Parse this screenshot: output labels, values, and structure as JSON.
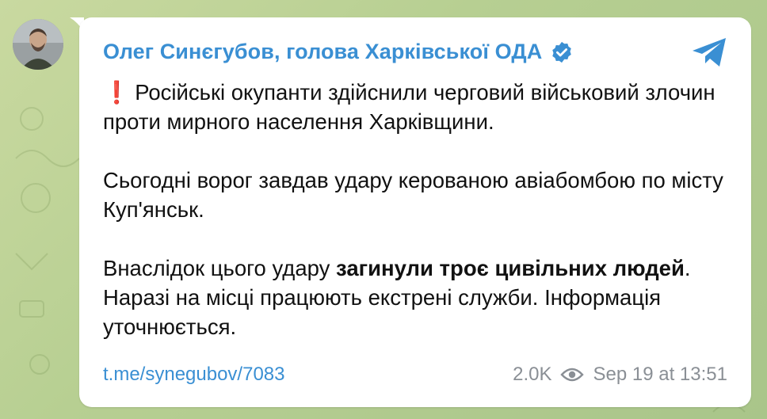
{
  "post": {
    "channel_name": "Олег Синєгубов, голова Харківської ОДА",
    "verified_icon": "verified-badge-icon",
    "telegram_icon": "telegram-plane-icon",
    "paragraphs": [
      {
        "prefix_icon": "❗",
        "text": "Російські окупанти здійснили черговий військовий злочин проти мирного населення Харківщини."
      },
      {
        "text": "Сьогодні ворог завдав удару керованою авіабомбою по місту Куп'янськ."
      },
      {
        "before_bold": "Внаслідок цього удару ",
        "bold": "загинули троє цивільних людей",
        "after_bold": ". Наразі на місці працюють екстрені служби. Інформація уточнюється."
      }
    ],
    "link": "t.me/synegubov/7083",
    "views": "2.0K",
    "views_icon": "eye-icon",
    "timestamp": "Sep 19 at 13:51"
  },
  "colors": {
    "accent": "#3a8fd3",
    "alert": "#e0312b",
    "meta": "#8a8f95",
    "background": "#b7cf92"
  }
}
